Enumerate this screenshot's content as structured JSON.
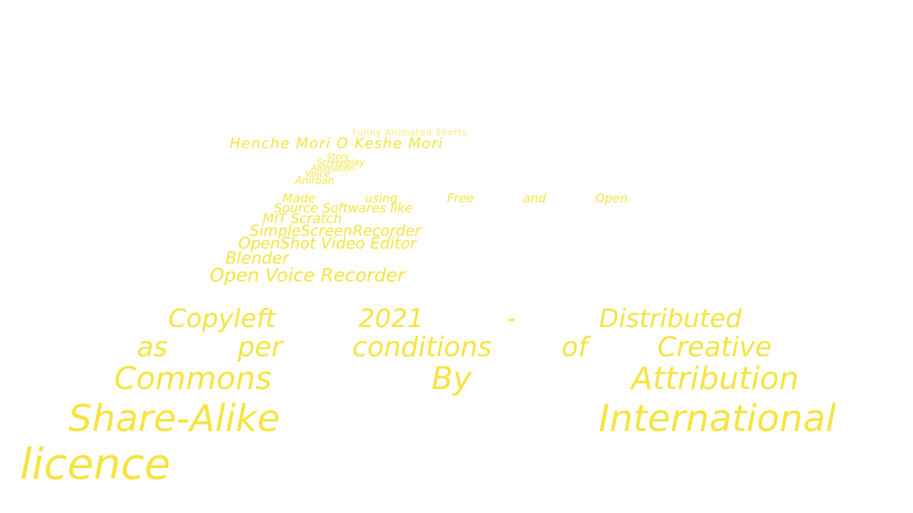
{
  "credits": {
    "series": "Funny Animated Shorts",
    "title": "Henche Mori O Keshe Mori",
    "roles": [
      "Story",
      "Screenplay",
      "Animation",
      "Voice"
    ],
    "author": "Anirban",
    "tools_lines": [
      [
        "Made",
        "using",
        "Free",
        "and",
        "Open"
      ],
      "Source Softwares like",
      "MIT Scratch",
      "SimpleScreenRecorder",
      "OpenShot Video Editor",
      "Blender",
      "Open Voice Recorder"
    ],
    "license_lines": [
      [
        "Copyleft",
        "2021",
        "-",
        "Distributed"
      ],
      [
        "as",
        "per",
        "conditions",
        "of",
        "Creative"
      ],
      [
        "Commons",
        "By",
        "Attribution"
      ],
      [
        "Share-Alike",
        "International"
      ],
      "licence"
    ]
  },
  "colors": {
    "text": "#f5e441",
    "background": "#ffffff"
  }
}
